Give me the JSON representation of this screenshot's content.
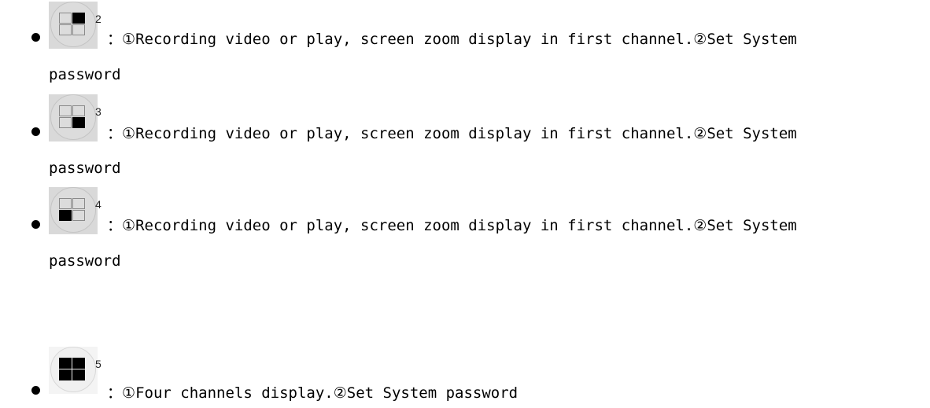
{
  "items": [
    {
      "icon": "layout-channel-2-icon",
      "number": "2",
      "highlight": "top-right",
      "separator": "：",
      "c1": "①",
      "text1": "Recording video or play, screen zoom display in first channel.",
      "c2": "②",
      "text2": "Set System",
      "continuation": "password"
    },
    {
      "icon": "layout-channel-3-icon",
      "number": "3",
      "highlight": "bottom-right",
      "separator": "：",
      "c1": "①",
      "text1": "Recording video or play, screen zoom display in first channel.",
      "c2": "②",
      "text2": "Set System",
      "continuation": "password"
    },
    {
      "icon": "layout-channel-4-icon",
      "number": "4",
      "highlight": "bottom-left",
      "separator": "：",
      "c1": "①",
      "text1": "Recording video or play, screen zoom display in first channel.",
      "c2": "②",
      "text2": "Set System",
      "continuation": "password"
    },
    {
      "icon": "layout-four-channels-icon",
      "number": "5",
      "highlight": "all",
      "separator": "：",
      "c1": "①",
      "text1": "Four channels display.",
      "c2": "②",
      "text2": "Set System password"
    }
  ]
}
